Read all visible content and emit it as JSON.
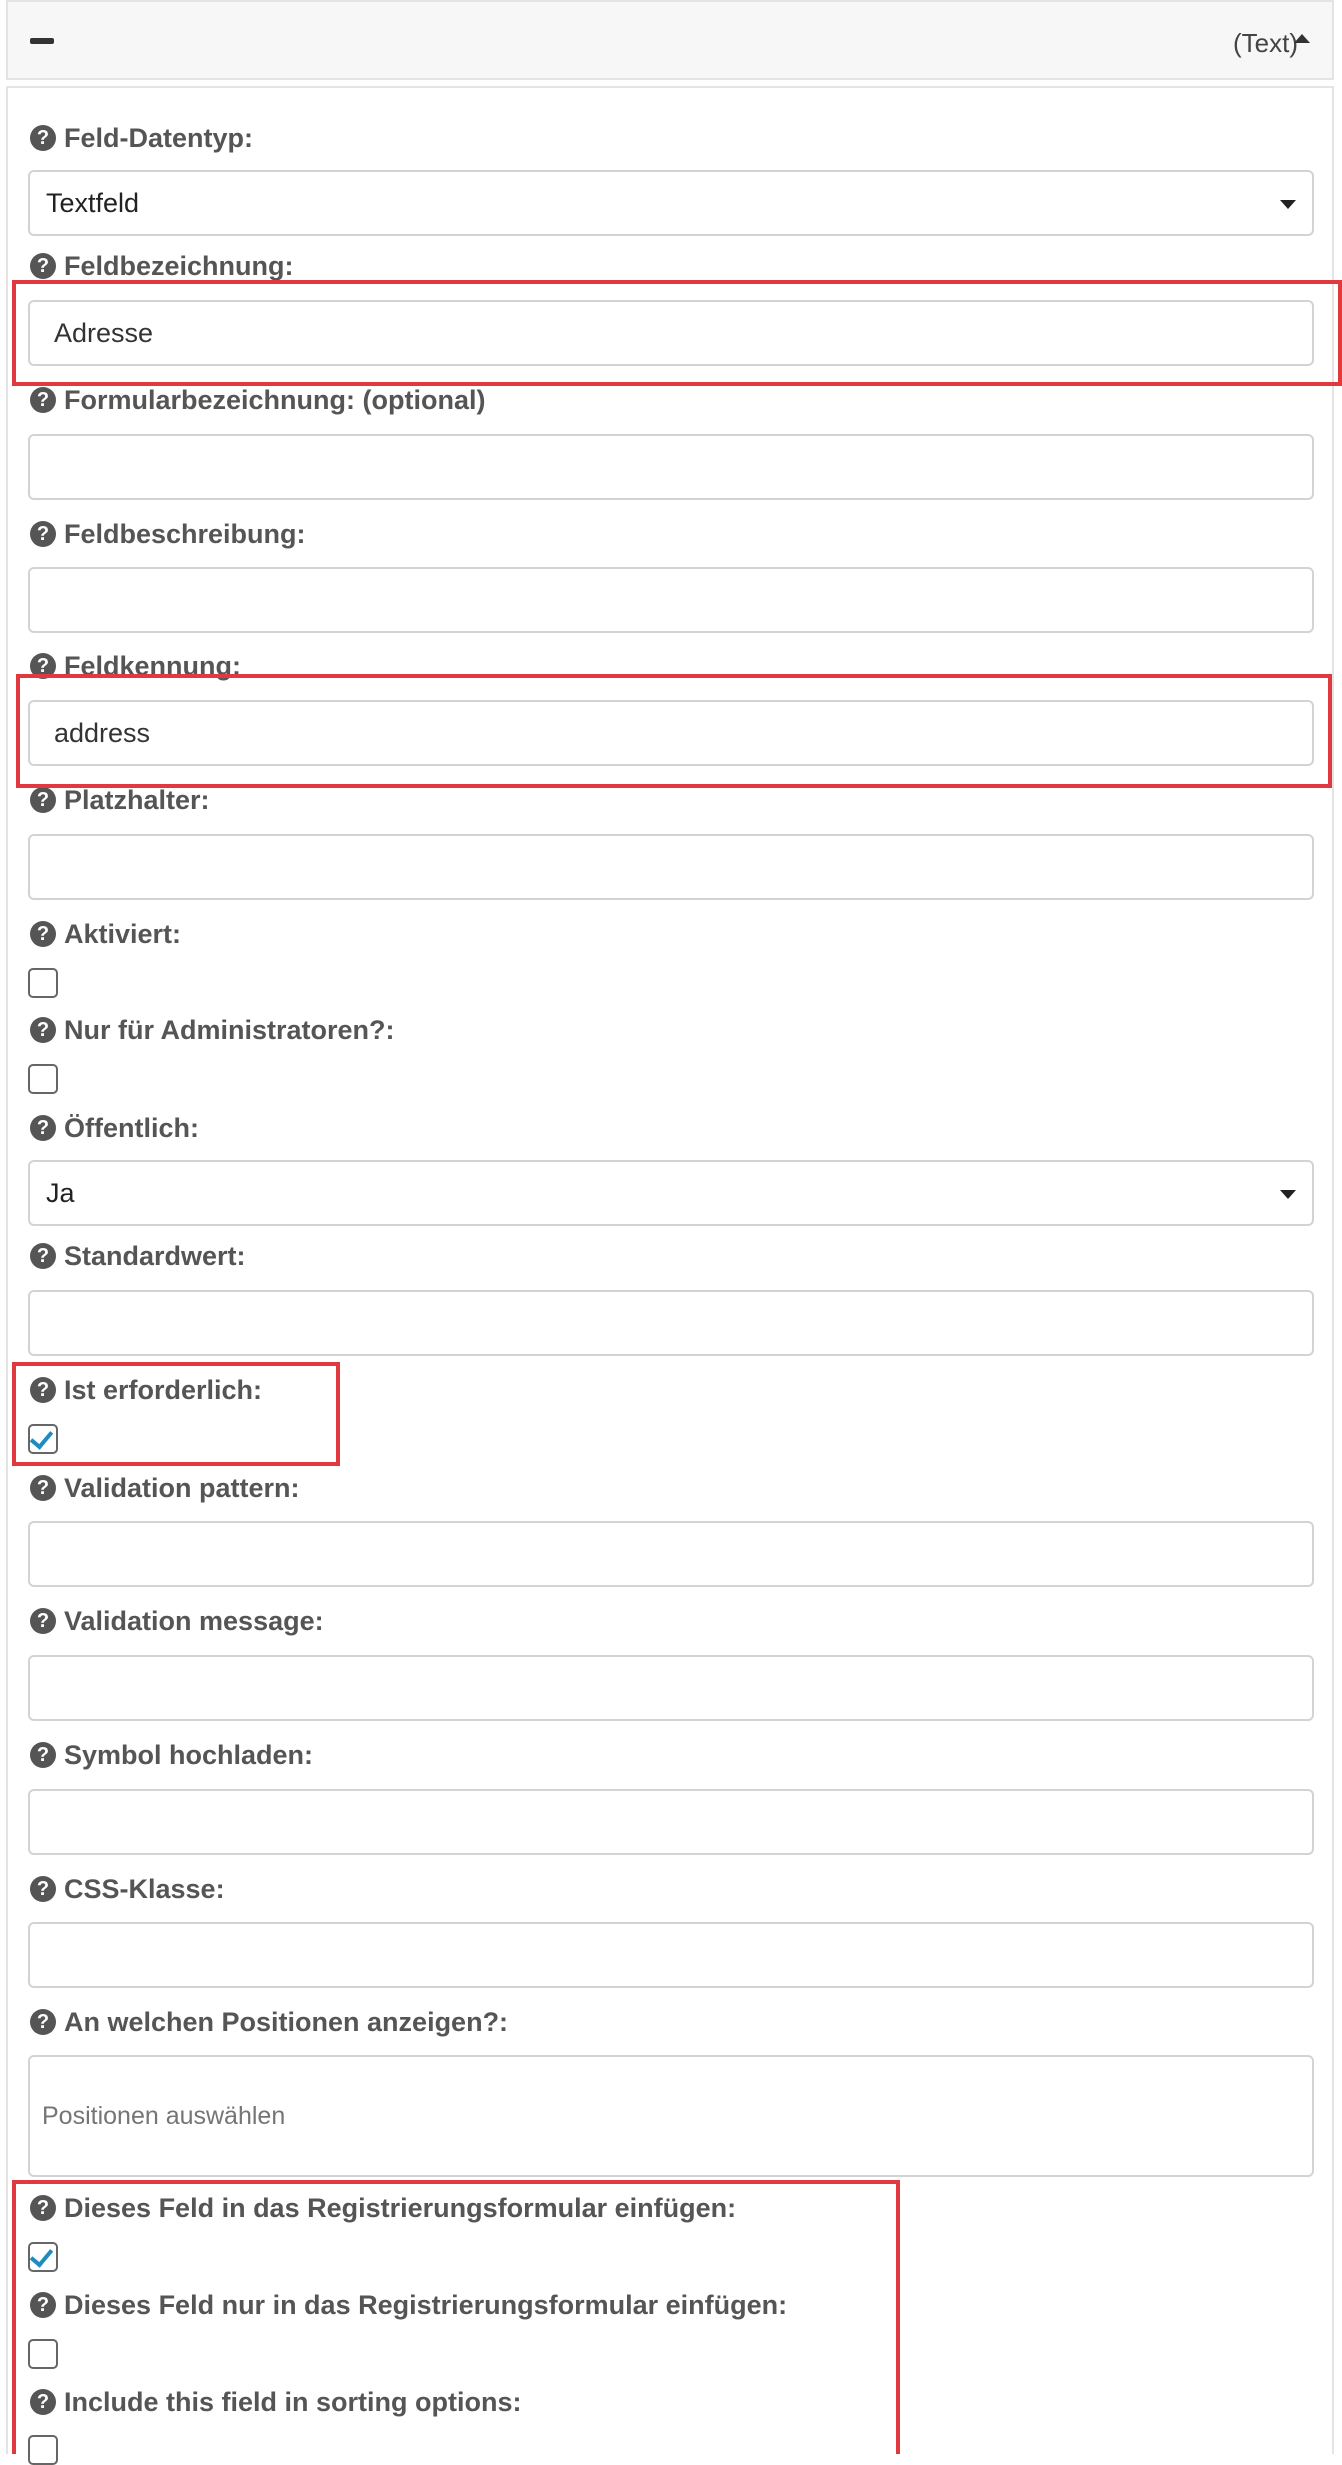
{
  "header": {
    "type_label": "(Text)"
  },
  "form": {
    "datatype": {
      "label": "Feld-Datentyp:",
      "value": "Textfeld"
    },
    "field_label": {
      "label": "Feldbezeichnung:",
      "value": "Adresse"
    },
    "form_label": {
      "label": "Formularbezeichnung: (optional)",
      "value": ""
    },
    "description": {
      "label": "Feldbeschreibung:",
      "value": ""
    },
    "identifier": {
      "label": "Feldkennung:",
      "value": "address"
    },
    "placeholder": {
      "label": "Platzhalter:",
      "value": ""
    },
    "enabled": {
      "label": "Aktiviert:",
      "checked": false
    },
    "admin_only": {
      "label": "Nur für Administratoren?:",
      "checked": false
    },
    "public": {
      "label": "Öffentlich:",
      "value": "Ja"
    },
    "default_value": {
      "label": "Standardwert:",
      "value": ""
    },
    "required": {
      "label": "Ist erforderlich:",
      "checked": true
    },
    "validation_pattern": {
      "label": "Validation pattern:",
      "value": ""
    },
    "validation_message": {
      "label": "Validation message:",
      "value": ""
    },
    "icon_upload": {
      "label": "Symbol hochladen:",
      "value": ""
    },
    "css_class": {
      "label": "CSS-Klasse:",
      "value": ""
    },
    "positions": {
      "label": "An welchen Positionen anzeigen?:",
      "placeholder": "Positionen auswählen"
    },
    "in_registration": {
      "label": "Dieses Feld in das Registrierungsformular einfügen:",
      "checked": true
    },
    "only_registration": {
      "label": "Dieses Feld nur in das Registrierungsformular einfügen:",
      "checked": false
    },
    "sorting": {
      "label": "Include this field in sorting options:",
      "checked": false
    }
  },
  "colors": {
    "highlight": "#e0393e",
    "check": "#1e8cbe"
  },
  "icons": {
    "help": "question-circle-icon",
    "collapse": "minus-icon",
    "caret": "caret-up-icon",
    "dropdown": "caret-down-icon"
  }
}
